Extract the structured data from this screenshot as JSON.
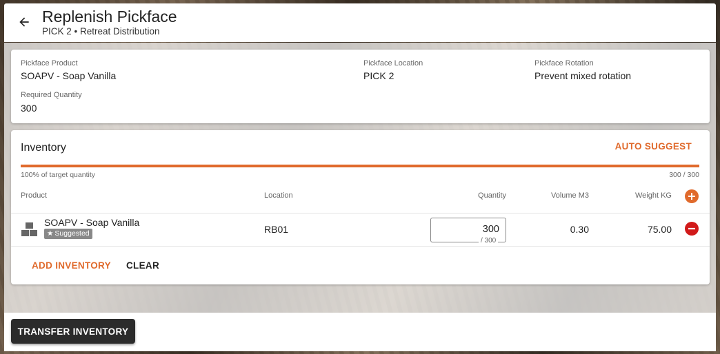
{
  "header": {
    "title": "Replenish Pickface",
    "subtitle": "PICK 2 • Retreat Distribution",
    "back_icon": "arrow-left-icon"
  },
  "details": {
    "product_label": "Pickface Product",
    "product_value": "SOAPV - Soap Vanilla",
    "location_label": "Pickface Location",
    "location_value": "PICK 2",
    "rotation_label": "Pickface Rotation",
    "rotation_value": "Prevent mixed rotation",
    "required_label": "Required Quantity",
    "required_value": "300"
  },
  "inventory": {
    "title": "Inventory",
    "auto_suggest_label": "AUTO SUGGEST",
    "progress_fraction": 1.0,
    "progress_left": "100% of target quantity",
    "progress_right": "300 / 300",
    "columns": {
      "product": "Product",
      "location": "Location",
      "quantity": "Quantity",
      "volume": "Volume M3",
      "weight": "Weight KG"
    },
    "rows": [
      {
        "product": "SOAPV - Soap Vanilla",
        "badge": "Suggested",
        "location": "RB01",
        "quantity": "300",
        "quantity_max": "/ 300",
        "volume": "0.30",
        "weight": "75.00"
      }
    ],
    "add_inventory_label": "ADD INVENTORY",
    "clear_label": "CLEAR"
  },
  "footer": {
    "transfer_label": "TRANSFER INVENTORY"
  },
  "colors": {
    "accent": "#e06a2c",
    "danger": "#d11a1a",
    "dark_button": "#2b2b2b"
  }
}
